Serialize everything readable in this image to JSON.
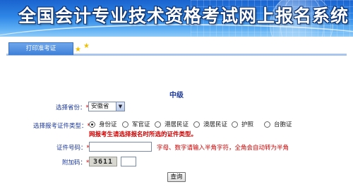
{
  "banner": {
    "title": "全国会计专业技术资格考试网上报名系统"
  },
  "tabs": {
    "print_ticket": "打印准考证"
  },
  "form": {
    "level": "中级",
    "province": {
      "label": "选择省份",
      "selected": "安徽省"
    },
    "id_type": {
      "label": "选择报考证件类型",
      "options": [
        {
          "label": "身份证",
          "checked": true
        },
        {
          "label": "军官证",
          "checked": false
        },
        {
          "label": "港居民证",
          "checked": false
        },
        {
          "label": "澳居民证",
          "checked": false
        },
        {
          "label": "护照",
          "checked": false
        },
        {
          "label": "台胞证",
          "checked": false
        }
      ],
      "warning": "网报考生请选择报名时所选的证件类型。"
    },
    "id_number": {
      "label": "证件号码",
      "value": "",
      "hint": "字母、数字请输入半角字符，全角会自动转为半角"
    },
    "captcha": {
      "label": "附加码",
      "code": "3611",
      "value": ""
    },
    "submit_label": "查询",
    "required_mark": "*",
    "colon": "："
  },
  "colors": {
    "banner_blue": "#2e86e6",
    "label_blue": "#1e3a9a",
    "warning_red": "#d00000"
  }
}
